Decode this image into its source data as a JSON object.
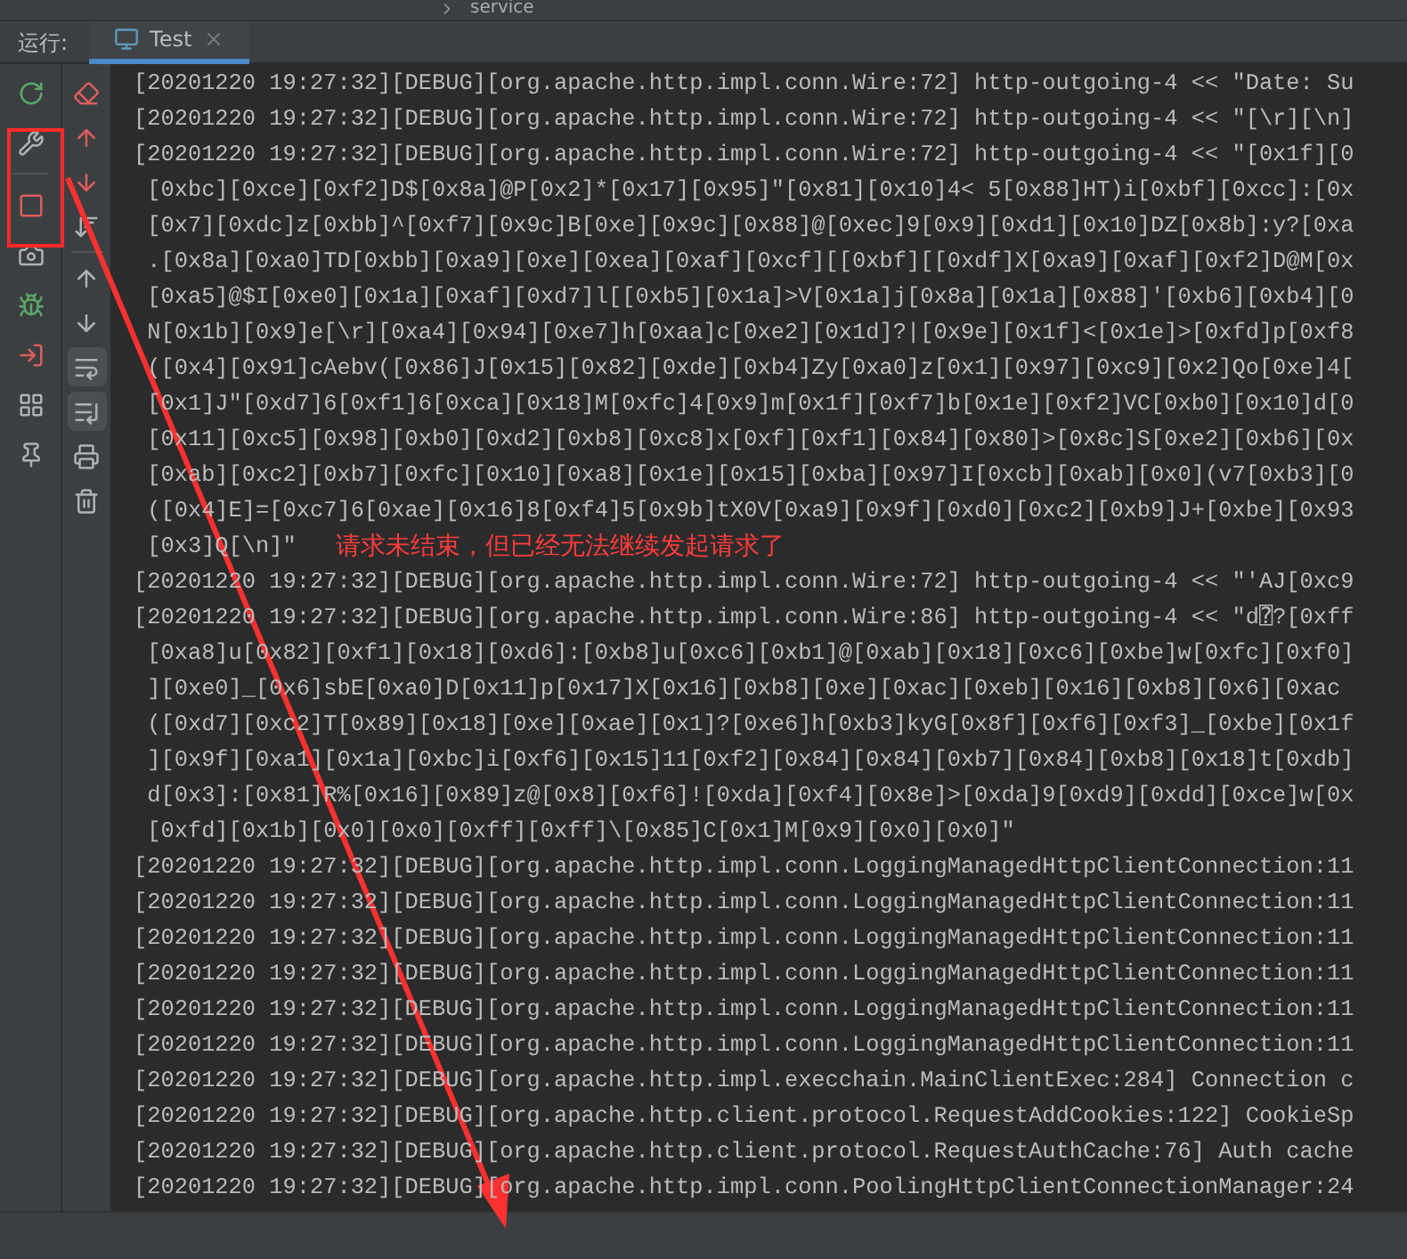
{
  "breadcrumb": {
    "item": "service"
  },
  "run_panel": {
    "label": "运行:",
    "tabs": [
      {
        "label": "Test",
        "selected": true,
        "closable": true
      }
    ]
  },
  "toggles": [
    {
      "kind": "wrap",
      "on": true
    },
    {
      "kind": "scroll_end",
      "on": true
    }
  ],
  "console": {
    "lines": [
      {
        "text": "[20201220 19:27:32][DEBUG][org.apache.http.impl.conn.Wire:72] http-outgoing-4 << \"Date: Su"
      },
      {
        "text": "[20201220 19:27:32][DEBUG][org.apache.http.impl.conn.Wire:72] http-outgoing-4 << \"[\\r][\\n]"
      },
      {
        "text": "[20201220 19:27:32][DEBUG][org.apache.http.impl.conn.Wire:72] http-outgoing-4 << \"[0x1f][0"
      },
      {
        "text": " [0xbc][0xce][0xf2]D$[0x8a]@P[0x2]*[0x17][0x95]\"[0x81][0x10]4< 5[0x88]HT)i[0xbf][0xcc]:[0x"
      },
      {
        "text": " [0x7][0xdc]z[0xbb]^[0xf7][0x9c]B[0xe][0x9c][0x88]@[0xec]9[0x9][0xd1][0x10]DZ[0x8b]:y?[0xa"
      },
      {
        "text": " .[0x8a][0xa0]TD[0xbb][0xa9][0xe][0xea][0xaf][0xcf][[0xbf][[0xdf]X[0xa9][0xaf][0xf2]D@M[0x"
      },
      {
        "text": " [0xa5]@$I[0xe0][0x1a][0xaf][0xd7]l[[0xb5][0x1a]>V[0x1a]j[0x8a][0x1a][0x88]'[0xb6][0xb4][0"
      },
      {
        "text": " N[0x1b][0x9]e[\\r][0xa4][0x94][0xe7]h[0xaa]c[0xe2][0x1d]?|[0x9e][0x1f]<[0x1e]>[0xfd]p[0xf8"
      },
      {
        "text": " ([0x4][0x91]cAebv([0x86]J[0x15][0x82][0xde][0xb4]Zy[0xa0]z[0x1][0x97][0xc9][0x2]Qo[0xe]4["
      },
      {
        "text": " [0x1]J\"[0xd7]6[0xf1]6[0xca][0x18]M[0xfc]4[0x9]m[0x1f][0xf7]b[0x1e][0xf2]VC[0xb0][0x10]d[0"
      },
      {
        "text": " [0x11][0xc5][0x98][0xb0][0xd2][0xb8][0xc8]x[0xf][0xf1][0x84][0x80]>[0x8c]S[0xe2][0xb6][0x"
      },
      {
        "text": " [0xab][0xc2][0xb7][0xfc][0x10][0xa8][0x1e][0x15][0xba][0x97]I[0xcb][0xab][0x0](v7[0xb3][0"
      },
      {
        "text": " ([0x4]E]=[0xc7]6[0xae][0x16]8[0xf4]5[0x9b]tX0V[0xa9][0x9f][0xd0][0xc2][0xb9]J+[0xbe][0x93"
      },
      {
        "text": " [0x3]Q[\\n]\"",
        "note": "请求未结束，但已经无法继续发起请求了"
      },
      {
        "text": "[20201220 19:27:32][DEBUG][org.apache.http.impl.conn.Wire:72] http-outgoing-4 << \"'AJ[0xc9"
      },
      {
        "text": "[20201220 19:27:32][DEBUG][org.apache.http.impl.conn.Wire:86] http-outgoing-4 << \"d⍰?[0xff"
      },
      {
        "text": " [0xa8]u[0x82][0xf1][0x18][0xd6]:[0xb8]u[0xc6][0xb1]@[0xab][0x18][0xc6][0xbe]w[0xfc][0xf0]"
      },
      {
        "text": " ][0xe0]_[0x6]sbE[0xa0]D[0x11]p[0x17]X[0x16][0xb8][0xe][0xac][0xeb][0x16][0xb8][0x6][0xac"
      },
      {
        "text": " ([0xd7][0xc2]T[0x89][0x18][0xe][0xae][0x1]?[0xe6]h[0xb3]kyG[0x8f][0xf6][0xf3]_[0xbe][0x1f"
      },
      {
        "text": " ][0x9f][0xa1][0x1a][0xbc]i[0xf6][0x15]11[0xf2][0x84][0x84][0xb7][0x84][0xb8][0x18]t[0xdb]"
      },
      {
        "text": " d[0x3]:[0x81]R%[0x16][0x89]z@[0x8][0xf6]![0xda][0xf4][0x8e]>[0xda]9[0xd9][0xdd][0xce]w[0x"
      },
      {
        "text": " [0xfd][0x1b][0x0][0x0][0xff][0xff]\\[0x85]C[0x1]M[0x9][0x0][0x0]\""
      },
      {
        "text": "[20201220 19:27:32][DEBUG][org.apache.http.impl.conn.LoggingManagedHttpClientConnection:11"
      },
      {
        "text": "[20201220 19:27:32][DEBUG][org.apache.http.impl.conn.LoggingManagedHttpClientConnection:11"
      },
      {
        "text": "[20201220 19:27:32][DEBUG][org.apache.http.impl.conn.LoggingManagedHttpClientConnection:11"
      },
      {
        "text": "[20201220 19:27:32][DEBUG][org.apache.http.impl.conn.LoggingManagedHttpClientConnection:11"
      },
      {
        "text": "[20201220 19:27:32][DEBUG][org.apache.http.impl.conn.LoggingManagedHttpClientConnection:11"
      },
      {
        "text": "[20201220 19:27:32][DEBUG][org.apache.http.impl.conn.LoggingManagedHttpClientConnection:11"
      },
      {
        "text": "[20201220 19:27:32][DEBUG][org.apache.http.impl.execchain.MainClientExec:284] Connection c"
      },
      {
        "text": "[20201220 19:27:32][DEBUG][org.apache.http.client.protocol.RequestAddCookies:122] CookieSp"
      },
      {
        "text": "[20201220 19:27:32][DEBUG][org.apache.http.client.protocol.RequestAuthCache:76] Auth cache"
      },
      {
        "text": "[20201220 19:27:32][DEBUG][org.apache.http.impl.conn.PoolingHttpClientConnectionManager:24"
      }
    ]
  }
}
